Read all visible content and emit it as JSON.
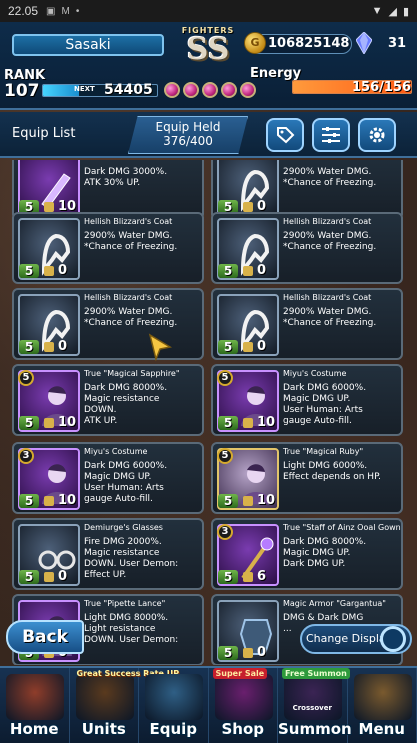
{
  "status_bar": {
    "time": "22.05",
    "icons": [
      "notification-a-icon",
      "notification-m-icon",
      "dot-icon"
    ],
    "right_icons": [
      "wifi-icon",
      "signal-icon",
      "battery-icon"
    ]
  },
  "header": {
    "player_name": "Sasaki",
    "rank_label": "RANK",
    "rank_value": "107",
    "next_label": "NEXT",
    "next_value": "54405",
    "next_progress_pct": 32,
    "emblem_word": "FIGHTERS",
    "emblem_grade": "SS",
    "orb_count": 5,
    "gil_value": "106825148",
    "lapis_value": "31",
    "energy_label": "Energy",
    "energy_value": "156/156",
    "energy_progress_pct": 100
  },
  "toolbar": {
    "equip_list_label": "Equip List",
    "equip_held_title": "Equip Held",
    "equip_held_count": "376/400",
    "buttons": [
      "tag-icon",
      "filter-icon",
      "settings-icon"
    ]
  },
  "items": [
    {
      "name": "",
      "desc": "Dark DMG 3000%.\nATK 30% UP.",
      "stars": "5",
      "count": "10",
      "thumb": "purple",
      "icon": "weapon-icon",
      "corner": ""
    },
    {
      "name": "",
      "desc": "2900% Water DMG.\n*Chance of Freezing.",
      "stars": "5",
      "count": "0",
      "thumb": "dark",
      "icon": "coat-icon",
      "corner": ""
    },
    {
      "name": "Hellish Blizzard's Coat",
      "desc": "2900% Water DMG.\n*Chance of Freezing.",
      "stars": "5",
      "count": "0",
      "thumb": "dark",
      "icon": "coat-icon",
      "corner": ""
    },
    {
      "name": "Hellish Blizzard's Coat",
      "desc": "2900% Water DMG.\n*Chance of Freezing.",
      "stars": "5",
      "count": "0",
      "thumb": "dark",
      "icon": "coat-icon",
      "corner": ""
    },
    {
      "name": "Hellish Blizzard's Coat",
      "desc": "2900% Water DMG.\n*Chance of Freezing.",
      "stars": "5",
      "count": "0",
      "thumb": "dark",
      "icon": "coat-icon",
      "corner": ""
    },
    {
      "name": "Hellish Blizzard's Coat",
      "desc": "2900% Water DMG.\n*Chance of Freezing.",
      "stars": "5",
      "count": "0",
      "thumb": "dark",
      "icon": "coat-icon",
      "corner": ""
    },
    {
      "name": "True \"Magical Sapphire\"",
      "desc": "Dark DMG 8000%.\nMagic resistance\nDOWN.\nATK UP.",
      "stars": "5",
      "count": "10",
      "thumb": "purple",
      "icon": "character-icon",
      "corner": "5"
    },
    {
      "name": "Miyu's Costume",
      "desc": "Dark DMG 6000%.\nMagic DMG UP.\nUser Human: Arts\ngauge Auto-fill.",
      "stars": "5",
      "count": "10",
      "thumb": "purple",
      "icon": "character-icon",
      "corner": "5"
    },
    {
      "name": "Miyu's Costume",
      "desc": "Dark DMG 6000%.\nMagic DMG UP.\nUser Human: Arts\ngauge Auto-fill.",
      "stars": "5",
      "count": "10",
      "thumb": "purple",
      "icon": "character-icon",
      "corner": "3"
    },
    {
      "name": "True \"Magical Ruby\"",
      "desc": "Light DMG 6000%.\nEffect depends on HP.",
      "stars": "5",
      "count": "10",
      "thumb": "gold",
      "icon": "character-icon",
      "corner": "5"
    },
    {
      "name": "Demiurge's Glasses",
      "desc": "Fire DMG 2000%.\nMagic resistance\nDOWN. User Demon:\nEffect UP.",
      "stars": "5",
      "count": "0",
      "thumb": "dark",
      "icon": "glasses-icon",
      "corner": ""
    },
    {
      "name": "True \"Staff of Ainz Ooal Gown\"",
      "desc": "Dark DMG 8000%.\nMagic DMG UP.\nDark DMG UP.",
      "stars": "5",
      "count": "6",
      "thumb": "purple",
      "icon": "staff-icon",
      "corner": "3"
    },
    {
      "name": "True \"Pipette Lance\"",
      "desc": "Light DMG 8000%.\nLight resistance\nDOWN. User Demon:",
      "stars": "5",
      "count": "0",
      "thumb": "purple",
      "icon": "character-icon",
      "corner": ""
    },
    {
      "name": "Magic Armor \"Gargantua\"",
      "desc": "DMG & Dark DMG\n...",
      "stars": "5",
      "count": "0",
      "thumb": "dark",
      "icon": "armor-icon",
      "corner": ""
    }
  ],
  "back_button": "Back",
  "change_display": "Change Display",
  "nav": [
    {
      "label": "Home",
      "tag": "",
      "tag_style": "",
      "sub": "",
      "art": "#8f3d2a"
    },
    {
      "label": "Units",
      "tag": "Great Success Rate UP",
      "tag_style": "orange",
      "sub": "",
      "art": "#5a3a1e"
    },
    {
      "label": "Equip",
      "tag": "",
      "tag_style": "",
      "sub": "",
      "art": "#2f5f85"
    },
    {
      "label": "Shop",
      "tag": "Super Sale",
      "tag_style": "red",
      "sub": "",
      "art": "#6a1f6e"
    },
    {
      "label": "Summon",
      "tag": "Free Summon",
      "tag_style": "green",
      "sub": "Crossover",
      "art": "#3b2454"
    },
    {
      "label": "Menu",
      "tag": "",
      "tag_style": "",
      "sub": "",
      "art": "#7a5a2e"
    }
  ],
  "colors": {
    "header_bg": "#0e2c4a",
    "accent_blue": "#7fc3ee",
    "energy_orange": "#ff7a28",
    "card_border": "#5a6a78"
  }
}
